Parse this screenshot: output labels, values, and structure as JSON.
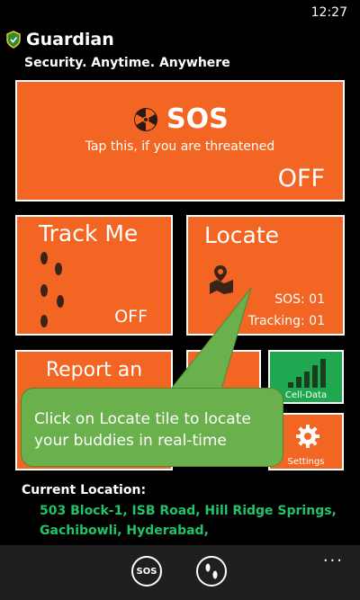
{
  "status_bar": {
    "time": "12:27"
  },
  "header": {
    "title": "Guardian",
    "tagline": "Security. Anytime. Anywhere"
  },
  "tiles": {
    "sos": {
      "title": "SOS",
      "subtitle": "Tap this, if you are threatened",
      "state": "OFF",
      "icon": "radiation-icon"
    },
    "track_me": {
      "title": "Track Me",
      "state": "OFF",
      "icon": "footprints-icon"
    },
    "locate": {
      "title": "Locate",
      "sos_count": "SOS: 01",
      "tracking_count": "Tracking: 01",
      "icon": "map-pin-icon"
    },
    "report": {
      "title": "Report an"
    },
    "cell_data": {
      "label": "Cell-Data",
      "icon": "signal-bars-icon"
    },
    "settings": {
      "label": "Settings",
      "icon": "gear-icon"
    }
  },
  "callout": {
    "text": "Click on Locate tile to locate your buddies in real-time"
  },
  "location": {
    "label": "Current Location:",
    "address": "503 Block-1, ISB Road, Hill Ridge Springs, Gachibowli, Hyderabad,"
  },
  "app_bar": {
    "sos_label": "SOS",
    "more": "..."
  },
  "colors": {
    "tile": "#f26522",
    "cell_tile": "#1fa84f",
    "callout": "#6ab04c",
    "address": "#22c36a"
  }
}
